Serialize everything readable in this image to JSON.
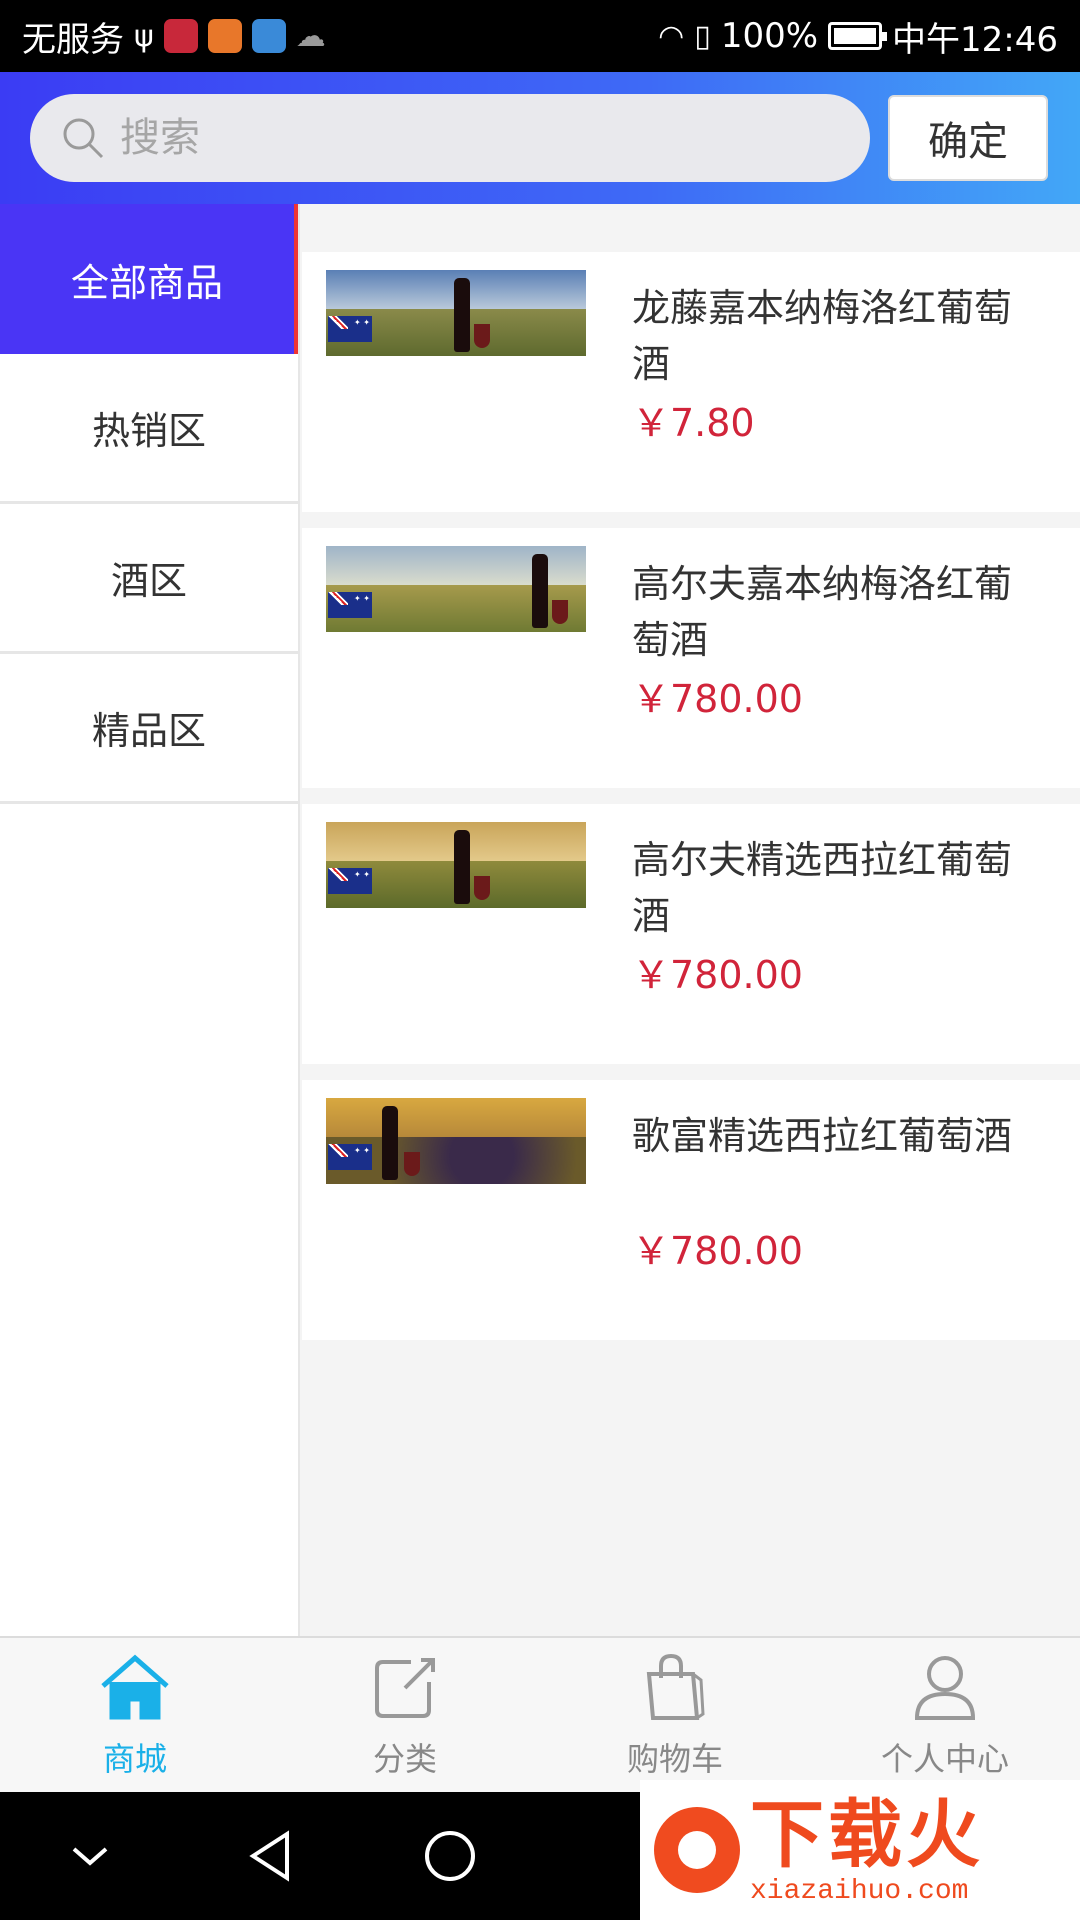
{
  "status_bar": {
    "carrier": "无服务",
    "battery": "100%",
    "battery_level": 1.0,
    "time": "中午12:46"
  },
  "search": {
    "placeholder": "搜索",
    "confirm_label": "确定"
  },
  "sidebar": {
    "items": [
      {
        "label": "全部商品",
        "active": true
      },
      {
        "label": "热销区",
        "active": false
      },
      {
        "label": "酒区",
        "active": false
      },
      {
        "label": "精品区",
        "active": false
      }
    ]
  },
  "products": [
    {
      "name": "龙藤嘉本纳梅洛红葡萄酒",
      "price": "￥7.80"
    },
    {
      "name": "高尔夫嘉本纳梅洛红葡萄酒",
      "price": "￥780.00"
    },
    {
      "name": "高尔夫精选西拉红葡萄酒",
      "price": "￥780.00"
    },
    {
      "name": "歌富精选西拉红葡萄酒",
      "price": "￥780.00"
    }
  ],
  "tabbar": {
    "items": [
      {
        "label": "商城",
        "icon": "home-icon",
        "active": true
      },
      {
        "label": "分类",
        "icon": "category-icon",
        "active": false
      },
      {
        "label": "购物车",
        "icon": "shopping-bag-icon",
        "active": false
      },
      {
        "label": "个人中心",
        "icon": "user-icon",
        "active": false
      }
    ]
  },
  "watermark": {
    "title": "下载火",
    "url": "xiazaihuo.com"
  },
  "colors": {
    "header_start": "#3b3cf4",
    "header_end": "#42a7f7",
    "sidebar_active": "#4a35f5",
    "price": "#d1243a",
    "tab_active": "#1ab0e8"
  }
}
